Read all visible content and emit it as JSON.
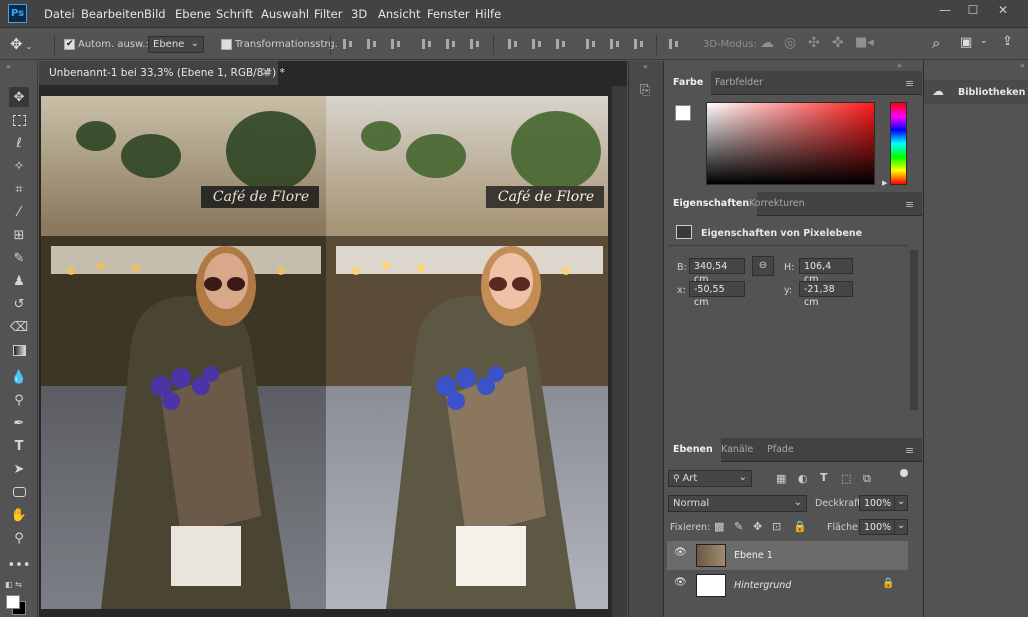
{
  "app": {
    "logo": "Ps"
  },
  "menu": [
    "Datei",
    "Bearbeiten",
    "Bild",
    "Ebene",
    "Schrift",
    "Auswahl",
    "Filter",
    "3D",
    "Ansicht",
    "Fenster",
    "Hilfe"
  ],
  "window_controls": {
    "minimize": "minimize-icon",
    "maximize": "maximize-icon",
    "close": "close-icon"
  },
  "options": {
    "auto_select_label": "Autom. ausw.:",
    "auto_select_checked": true,
    "auto_select_value": "Ebene",
    "transform_label": "Transformationsstrg.",
    "transform_checked": false,
    "mode_3d": "3D-Modus:"
  },
  "document": {
    "tab_title": "Unbenannt-1 bei 33,3% (Ebene 1, RGB/8#) *",
    "image_sign": "Café de Flore"
  },
  "panels": {
    "color": {
      "tabs": [
        "Farbe",
        "Farbfelder"
      ],
      "active": "Farbe",
      "hue_color": "#ff1a1a"
    },
    "properties": {
      "tabs": [
        "Eigenschaften",
        "Korrekturen"
      ],
      "active": "Eigenschaften",
      "title": "Eigenschaften von Pixelebene",
      "B_label": "B:",
      "B": "340,54 cm",
      "H_label": "H:",
      "H": "106,4 cm",
      "x_label": "x:",
      "x": "-50,55 cm",
      "y_label": "y:",
      "y": "-21,38 cm"
    },
    "layers": {
      "tabs": [
        "Ebenen",
        "Kanäle",
        "Pfade"
      ],
      "active": "Ebenen",
      "filter_kind": "Art",
      "blend_mode": "Normal",
      "opacity_label": "Deckkraft:",
      "opacity": "100%",
      "lock_label": "Fixieren:",
      "fill_label": "Fläche:",
      "fill": "100%",
      "items": [
        {
          "name": "Ebene 1",
          "selected": true,
          "italic": false,
          "locked": false
        },
        {
          "name": "Hintergrund",
          "selected": false,
          "italic": true,
          "locked": true
        }
      ]
    },
    "libraries": {
      "title": "Bibliotheken"
    }
  },
  "colors": {
    "accent": "#31a8ff",
    "menubar": "#434343",
    "panel": "#535353"
  }
}
